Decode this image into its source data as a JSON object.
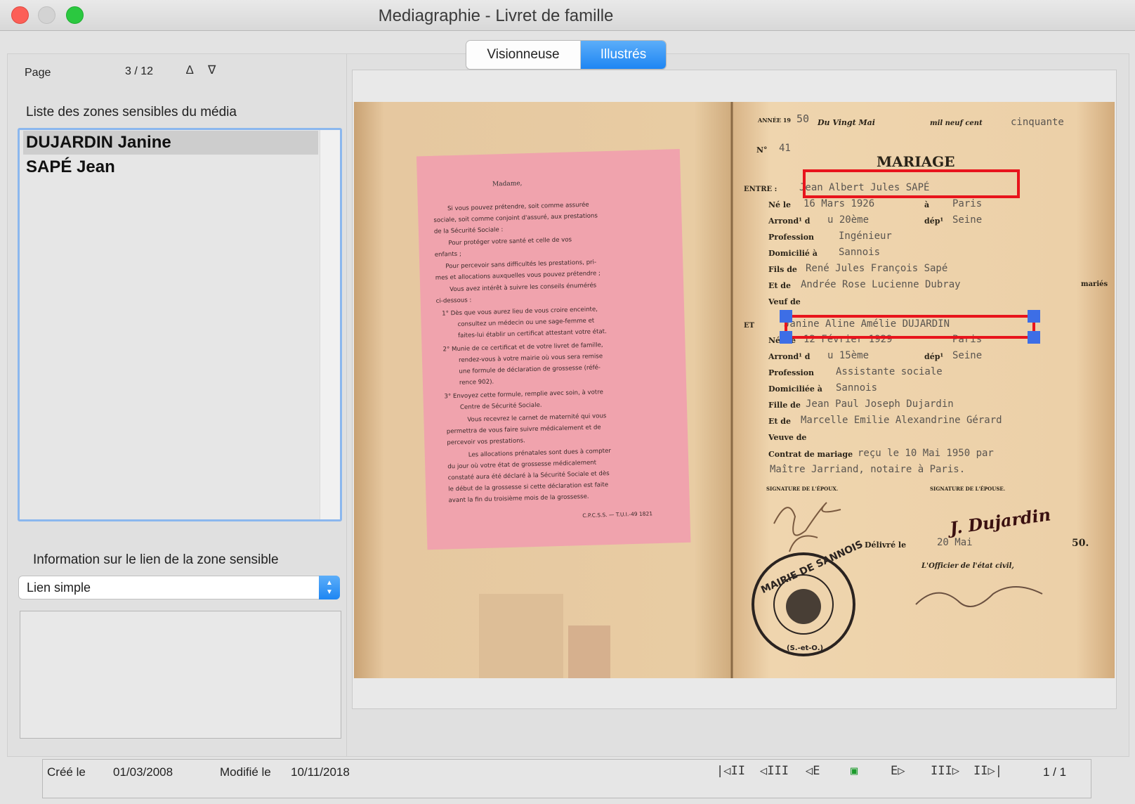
{
  "window": {
    "title": "Mediagraphie  - Livret de famille"
  },
  "tabs": [
    {
      "label": "Visionneuse",
      "selected": false
    },
    {
      "label": "Illustrés",
      "selected": true
    }
  ],
  "pager": {
    "label": "Page",
    "value": "3 / 12",
    "prev_glyph": "∆",
    "next_glyph": "∇"
  },
  "zones": {
    "heading": "Liste des zones sensibles du média",
    "items": [
      {
        "label": "DUJARDIN Janine",
        "selected": true
      },
      {
        "label": "SAPÉ Jean",
        "selected": false
      }
    ]
  },
  "link_info": {
    "heading": "Information sur le lien de la zone sensible",
    "select_value": "Lien simple",
    "notes": ""
  },
  "document": {
    "left_page": {
      "greeting": "Madame,",
      "lines": [
        "Si vous pouvez prétendre, soit comme assurée",
        "sociale, soit comme conjoint d'assuré, aux prestations",
        "de la Sécurité Sociale :",
        "Pour protéger votre santé et celle de vos",
        "enfants ;",
        "Pour percevoir sans difficultés les prestations, pri-",
        "mes et allocations auxquelles vous pouvez prétendre ;",
        "Vous avez intérêt à suivre les conseils énumérés",
        "ci-dessous :",
        "1° Dès que vous aurez lieu de vous croire enceinte,",
        "consultez un médecin ou une sage-femme et",
        "faites-lui établir un certificat attestant votre état.",
        "2° Munie de ce certificat et de votre livret de famille,",
        "rendez-vous à votre mairie où vous sera remise",
        "une formule de déclaration de grossesse (réfé-",
        "rence 902).",
        "3° Envoyez cette formule, remplie avec soin, à votre",
        "Centre de Sécurité Sociale.",
        "Vous recevrez le carnet de maternité qui vous",
        "permettra de vous faire suivre médicalement et de",
        "percevoir vos prestations.",
        "Les allocations prénatales sont dues à compter",
        "du jour où votre état de grossesse médicalement",
        "constaté aura été déclaré à la Sécurité Sociale et dès",
        "le début de la grossesse si cette déclaration est faite",
        "avant la fin du troisième mois de la grossesse."
      ],
      "footer": "C.P.C.S.S. — T.U.I.-49  1821"
    },
    "right_page": {
      "annee_label": "ANNÉE 19",
      "annee_value": "50",
      "date_text": "Du Vingt Mai",
      "mil_label": "mil neuf cent",
      "mil_value": "cinquante",
      "no_label": "N°",
      "no_value": "41",
      "heading": "MARIAGE",
      "entre_label": "ENTRE :",
      "entre_value": "Jean Albert Jules SAPÉ",
      "ne_label": "Né le",
      "ne_value": "16 Mars 1926",
      "a_label": "à",
      "a_value": "Paris",
      "arrond_label": "Arrond¹ d",
      "arrond_value": "u 20ème",
      "dep_label": "dép¹",
      "dep_value": "Seine",
      "prof_label": "Profession",
      "prof_value": "Ingénieur",
      "dom_label": "Domicilié à",
      "dom_value": "Sannois",
      "fils_label": "Fils de",
      "fils_value": "René Jules François Sapé",
      "etde_label": "Et de",
      "etde_value": "Andrée Rose Lucienne Dubray",
      "maries": "mariés",
      "veuf_label": "Veuf de",
      "et_label": "ET",
      "et_value": "Janine Aline Amélie DUJARDIN",
      "nee_label": "Née le",
      "nee_value": "12 Février 1929",
      "a2_value": "Paris",
      "arrond2_value": "u 15ème",
      "dep2_value": "Seine",
      "prof2_value": "Assistante sociale",
      "dom2_label": "Domiciliée à",
      "dom2_value": "Sannois",
      "fille_label": "Fille de",
      "fille_value": "Jean Paul Joseph Dujardin",
      "etde2_value": "Marcelle Emilie Alexandrine Gérard",
      "veuve_label": "Veuve de",
      "contrat_label": "Contrat de mariage",
      "contrat_value": "reçu le 10 Mai 1950 par",
      "contrat_value2": "Maître Jarriand, notaire à Paris.",
      "sig_epoux": "SIGNATURE DE L'ÉPOUX.",
      "sig_epouse": "SIGNATURE DE L'ÉPOUSE.",
      "signature_text": "J. Dujardin",
      "delivre_label": "Délivré le",
      "delivre_value": "20 Mai",
      "delivre_year": "50.",
      "officier": "L'Officier de l'état civil,",
      "stamp_text": "MAIRIE DE SANNOIS",
      "stamp_sub": "(S.-et-O.)"
    }
  },
  "status": {
    "created_label": "Créé le",
    "created_value": "01/03/2008",
    "modified_label": "Modifié le",
    "modified_value": "10/11/2018",
    "nav": [
      "|◁II",
      "◁III",
      "◁E",
      "▣",
      "E▷",
      "III▷",
      "II▷|"
    ],
    "count": "1 / 1"
  },
  "colors": {
    "accent": "#1e86f3",
    "highlight_red": "#e8141c",
    "handle_blue": "#3d6ee6",
    "pink_slip": "#f0a3ad",
    "paper": "#e9c69a"
  }
}
